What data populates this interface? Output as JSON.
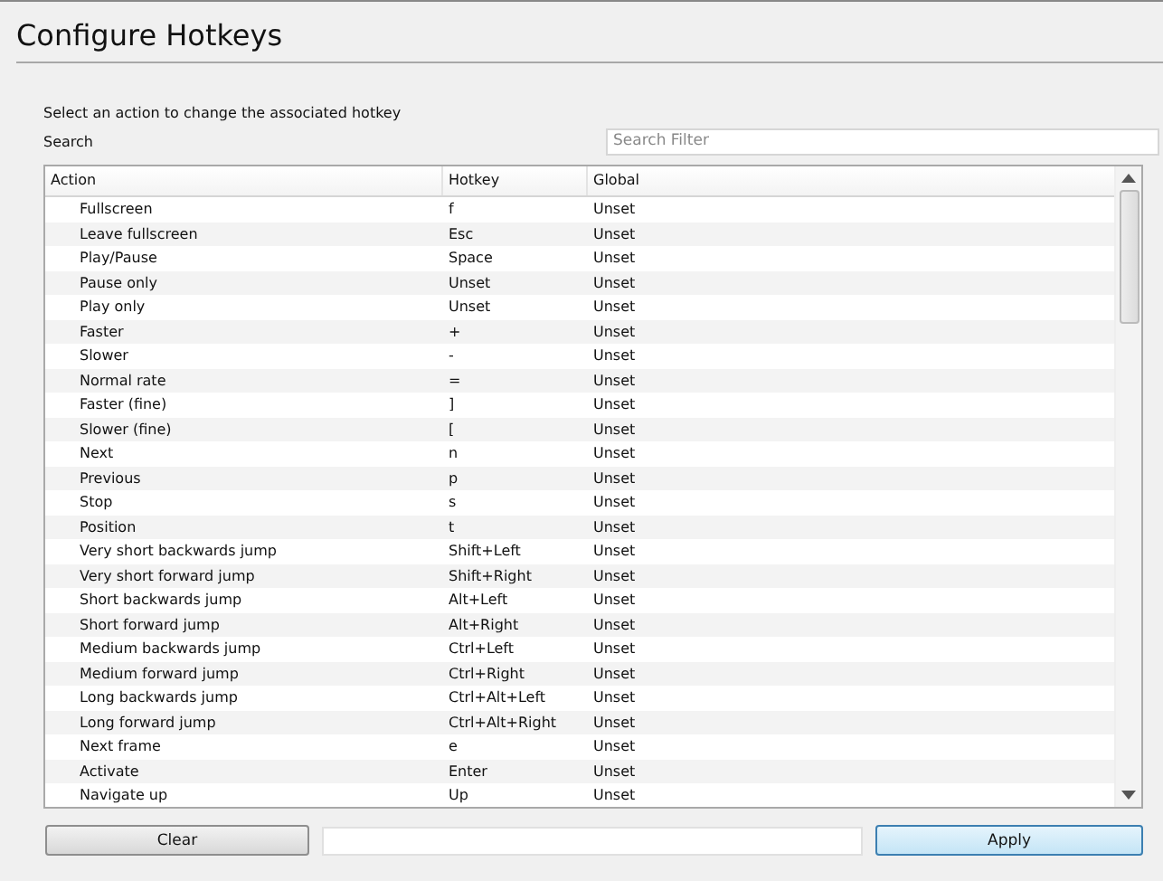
{
  "title": "Configure Hotkeys",
  "description": "Select an action to change the associated hotkey",
  "search": {
    "label": "Search",
    "placeholder": "Search Filter"
  },
  "table": {
    "columns": [
      "Action",
      "Hotkey",
      "Global"
    ],
    "rows": [
      {
        "action": "Fullscreen",
        "hotkey": "f",
        "global": "Unset"
      },
      {
        "action": "Leave fullscreen",
        "hotkey": "Esc",
        "global": "Unset"
      },
      {
        "action": "Play/Pause",
        "hotkey": "Space",
        "global": "Unset"
      },
      {
        "action": "Pause only",
        "hotkey": "Unset",
        "global": "Unset"
      },
      {
        "action": "Play only",
        "hotkey": "Unset",
        "global": "Unset"
      },
      {
        "action": "Faster",
        "hotkey": "+",
        "global": "Unset"
      },
      {
        "action": "Slower",
        "hotkey": "-",
        "global": "Unset"
      },
      {
        "action": "Normal rate",
        "hotkey": "=",
        "global": "Unset"
      },
      {
        "action": "Faster (fine)",
        "hotkey": "]",
        "global": "Unset"
      },
      {
        "action": "Slower (fine)",
        "hotkey": "[",
        "global": "Unset"
      },
      {
        "action": "Next",
        "hotkey": "n",
        "global": "Unset"
      },
      {
        "action": "Previous",
        "hotkey": "p",
        "global": "Unset"
      },
      {
        "action": "Stop",
        "hotkey": "s",
        "global": "Unset"
      },
      {
        "action": "Position",
        "hotkey": "t",
        "global": "Unset"
      },
      {
        "action": "Very short backwards jump",
        "hotkey": "Shift+Left",
        "global": "Unset"
      },
      {
        "action": "Very short forward jump",
        "hotkey": "Shift+Right",
        "global": "Unset"
      },
      {
        "action": "Short backwards jump",
        "hotkey": "Alt+Left",
        "global": "Unset"
      },
      {
        "action": "Short forward jump",
        "hotkey": "Alt+Right",
        "global": "Unset"
      },
      {
        "action": "Medium backwards jump",
        "hotkey": "Ctrl+Left",
        "global": "Unset"
      },
      {
        "action": "Medium forward jump",
        "hotkey": "Ctrl+Right",
        "global": "Unset"
      },
      {
        "action": "Long backwards jump",
        "hotkey": "Ctrl+Alt+Left",
        "global": "Unset"
      },
      {
        "action": "Long forward jump",
        "hotkey": "Ctrl+Alt+Right",
        "global": "Unset"
      },
      {
        "action": "Next frame",
        "hotkey": "e",
        "global": "Unset"
      },
      {
        "action": "Activate",
        "hotkey": "Enter",
        "global": "Unset"
      },
      {
        "action": "Navigate up",
        "hotkey": "Up",
        "global": "Unset"
      }
    ]
  },
  "buttons": {
    "clear": "Clear",
    "apply": "Apply"
  }
}
